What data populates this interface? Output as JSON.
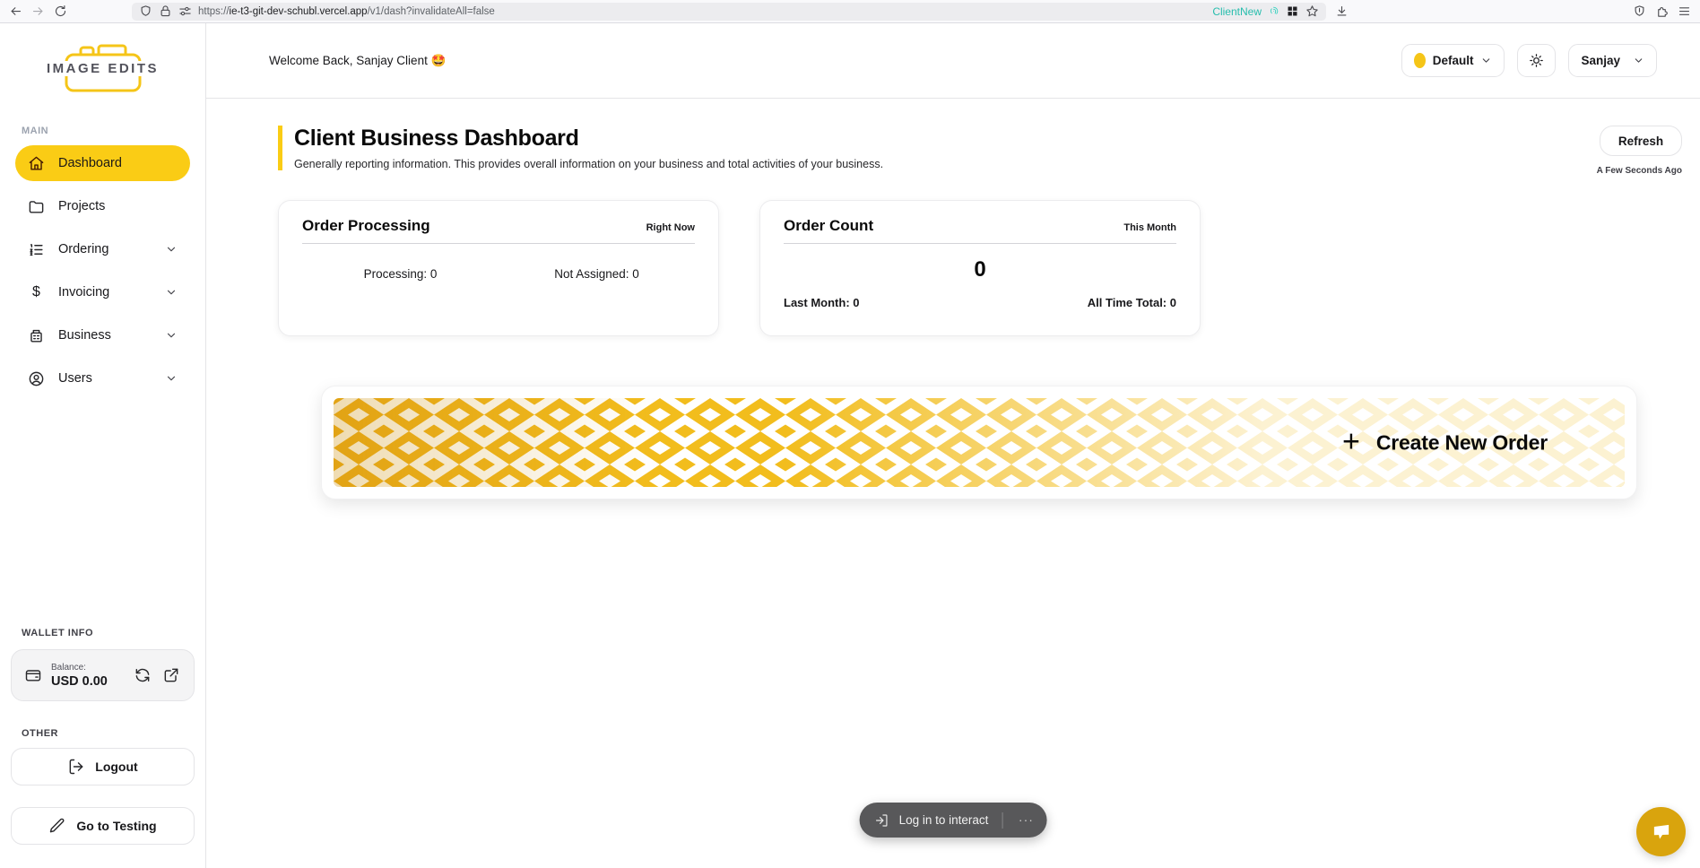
{
  "browser": {
    "url_scheme": "https://",
    "url_domain": "ie-t3-git-dev-schubl.vercel.app",
    "url_path": "/v1/dash?invalidateAll=false",
    "profile_label": "ClientNew"
  },
  "sidebar": {
    "logo_text": "IMAGE EDITS",
    "sections": {
      "main": "MAIN",
      "wallet": "WALLET INFO",
      "other": "OTHER"
    },
    "items": [
      {
        "label": "Dashboard",
        "active": true
      },
      {
        "label": "Projects",
        "active": false
      },
      {
        "label": "Ordering",
        "active": false,
        "expandable": true
      },
      {
        "label": "Invoicing",
        "active": false,
        "expandable": true
      },
      {
        "label": "Business",
        "active": false,
        "expandable": true
      },
      {
        "label": "Users",
        "active": false,
        "expandable": true
      }
    ],
    "wallet": {
      "balance_label": "Balance:",
      "balance_value": "USD 0.00"
    },
    "logout_label": "Logout",
    "testing_label": "Go to Testing"
  },
  "header": {
    "welcome": "Welcome Back, Sanjay Client",
    "welcome_emoji": "🤩",
    "workspace_label": "Default",
    "user_label": "Sanjay"
  },
  "dashboard": {
    "title": "Client Business Dashboard",
    "subtitle": "Generally reporting information. This provides overall information on your business and total activities of your business.",
    "refresh_label": "Refresh",
    "refresh_note": "A Few Seconds Ago",
    "order_processing": {
      "title": "Order Processing",
      "badge": "Right Now",
      "stat1_label": "Processing:",
      "stat1_value": "0",
      "stat2_label": "Not Assigned:",
      "stat2_value": "0"
    },
    "order_count": {
      "title": "Order Count",
      "badge": "This Month",
      "value": "0",
      "foot1_label": "Last Month:",
      "foot1_value": "0",
      "foot2_label": "All Time Total:",
      "foot2_value": "0"
    },
    "create_order_label": "Create New Order"
  },
  "toast": {
    "message": "Log in to interact",
    "more": "···"
  },
  "icons": {
    "dollar": "$",
    "plus": "+"
  },
  "colors": {
    "accent": "#FACC15",
    "pattern_gold": "#F2BD1D",
    "chat_fab": "#D9A40D",
    "profile_teal": "#26BDAD",
    "toast_bg": "#58585A"
  }
}
